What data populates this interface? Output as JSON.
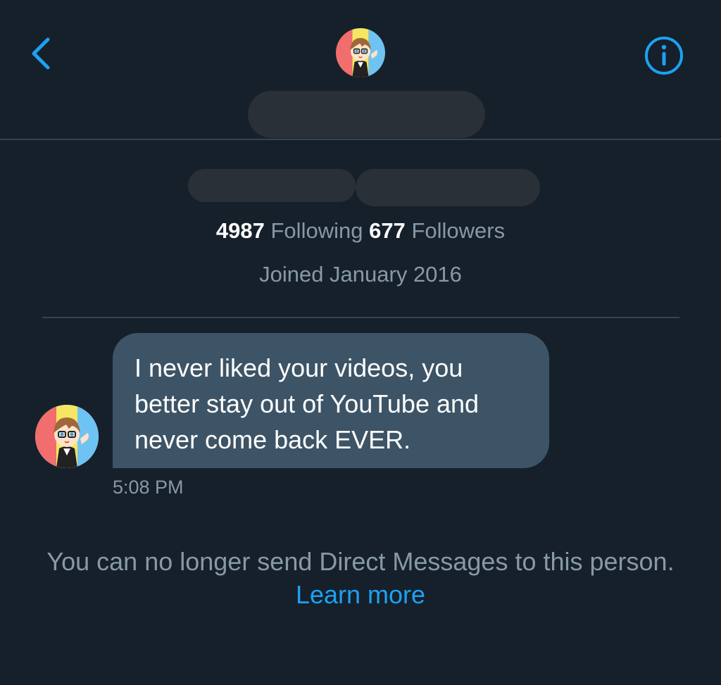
{
  "header": {
    "back_icon": "chevron-left-icon",
    "info_icon": "info-circle-icon",
    "accent_color": "#1da1f2"
  },
  "profile": {
    "following_count": "4987",
    "following_label": "Following",
    "followers_count": "677",
    "followers_label": "Followers",
    "joined": "Joined January 2016"
  },
  "conversation": {
    "messages": [
      {
        "text": "I never liked your videos, you better stay out of YouTube and never come back EVER.",
        "time": "5:08 PM"
      }
    ]
  },
  "footer": {
    "notice": "You can no longer send Direct Messages to this person.",
    "learn_more": "Learn more"
  },
  "colors": {
    "background": "#15202b",
    "bubble": "#3d5466",
    "muted_text": "#8899a6",
    "divider": "#38444d"
  }
}
